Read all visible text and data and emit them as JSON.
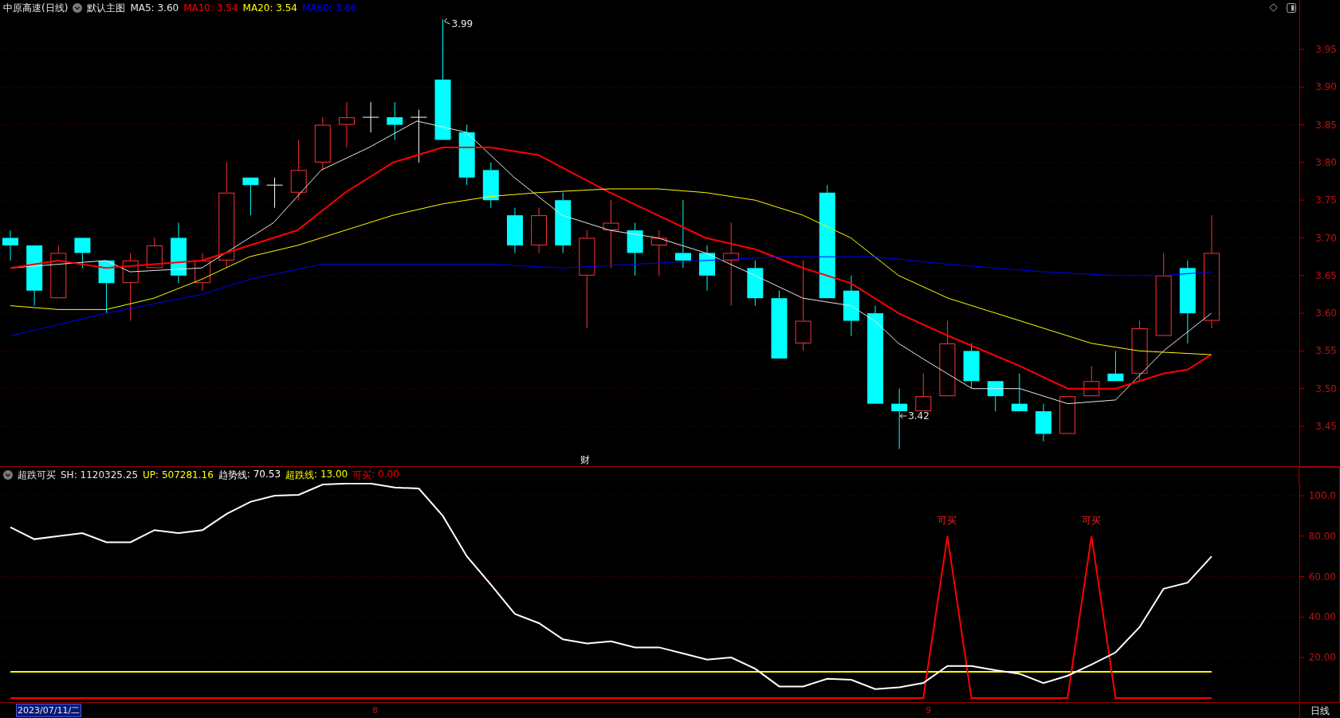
{
  "main_panel": {
    "title": "中原高速(日线)",
    "template": "默认主图",
    "indicators": [
      {
        "label": "MA5: 3.60",
        "color": "#e6e6e6"
      },
      {
        "label": "MA10: 3.54",
        "color": "#ff0000"
      },
      {
        "label": "MA20: 3.54",
        "color": "#ffff00"
      },
      {
        "label": "MA60: 3.66",
        "color": "#0000ff"
      }
    ],
    "price_axis": [
      "3.95",
      "3.90",
      "3.85",
      "3.80",
      "3.75",
      "3.70",
      "3.65",
      "3.60",
      "3.55",
      "3.50",
      "3.45"
    ],
    "high_label": "3.99",
    "low_label": "3.42",
    "event_marker": "财"
  },
  "indicator_panel": {
    "title": "超跌可买",
    "readouts": [
      {
        "label": "SH: 1120325.25",
        "color": "#e6e6e6"
      },
      {
        "label": "UP: 507281.16",
        "color": "#ffff00"
      }
    ],
    "series_values": [
      ": 70.53",
      ": 13.00",
      ": 0.00"
    ],
    "chart_data": {
      "type": "line",
      "ylim": [
        -2.4,
        106.3
      ],
      "grid": true,
      "yticks": [
        {
          "value": 20,
          "label": "20.00"
        },
        {
          "value": 40,
          "label": "40.00"
        },
        {
          "value": 60,
          "label": "60.00"
        },
        {
          "value": 80,
          "label": "80.00"
        },
        {
          "value": 100,
          "label": "100.0"
        }
      ],
      "series": [
        {
          "name": "趋势线",
          "color": "#ffffff",
          "values": [
            84.4,
            78.5,
            80,
            81.5,
            77,
            77,
            83,
            81.5,
            83,
            91,
            97,
            100,
            100.4,
            105.5,
            106,
            106,
            104,
            103.5,
            90,
            70,
            56,
            41.5,
            37,
            29,
            27,
            28,
            25,
            25,
            22,
            19,
            20,
            14.5,
            5.7,
            5.7,
            9.5,
            9,
            4.4,
            5.3,
            7.4,
            15.8,
            15.8,
            13.7,
            12,
            7.4,
            11,
            16.6,
            22.5,
            35,
            54,
            57,
            70
          ]
        },
        {
          "name": "超跌线",
          "color": "#ffff00",
          "values": [
            13,
            13,
            13,
            13,
            13,
            13,
            13,
            13,
            13,
            13,
            13,
            13,
            13,
            13,
            13,
            13,
            13,
            13,
            13,
            13,
            13,
            13,
            13,
            13,
            13,
            13,
            13,
            13,
            13,
            13,
            13,
            13,
            13,
            13,
            13,
            13,
            13,
            13,
            13,
            13,
            13,
            13,
            13,
            13,
            13,
            13,
            13,
            13,
            13,
            13,
            13
          ]
        },
        {
          "name": "可买",
          "color": "#ff0000",
          "values": [
            0,
            0,
            0,
            0,
            0,
            0,
            0,
            0,
            0,
            0,
            0,
            0,
            0,
            0,
            0,
            0,
            0,
            0,
            0,
            0,
            0,
            0,
            0,
            0,
            0,
            0,
            0,
            0,
            0,
            0,
            0,
            0,
            0,
            0,
            0,
            0,
            0,
            0,
            0,
            80,
            0,
            0,
            0,
            0,
            0,
            80,
            0,
            0,
            0,
            0,
            0
          ]
        }
      ],
      "annotations": [
        "可买",
        "可买"
      ]
    }
  },
  "time_axis": {
    "labels": [
      {
        "label": "2023/07/11/二",
        "selected": true
      },
      {
        "label": "8",
        "selected": false
      },
      {
        "label": "9",
        "selected": false
      }
    ],
    "period": "日线"
  }
}
